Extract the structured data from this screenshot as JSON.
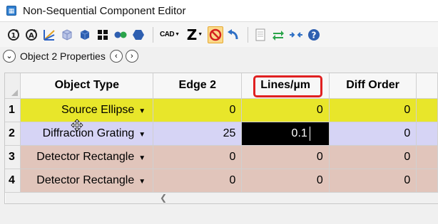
{
  "window": {
    "title": "Non-Sequential Component Editor"
  },
  "toolbar": {
    "cad_label": "CAD",
    "z_label": "Z"
  },
  "properties": {
    "label": "Object 2 Properties"
  },
  "table": {
    "columns": [
      "Object Type",
      "Edge 2",
      "Lines/µm",
      "Diff Order",
      ""
    ],
    "rows": [
      {
        "num": "1",
        "type": "Source Ellipse",
        "edge2": "0",
        "lines": "0",
        "diff": "0"
      },
      {
        "num": "2",
        "type": "Diffraction Grating",
        "edge2": "25",
        "lines": "0.1",
        "diff": "0"
      },
      {
        "num": "3",
        "type": "Detector Rectangle",
        "edge2": "0",
        "lines": "0",
        "diff": "0"
      },
      {
        "num": "4",
        "type": "Detector Rectangle",
        "edge2": "0",
        "lines": "0",
        "diff": "0"
      }
    ],
    "row_colors": [
      "#e8e62a",
      "#d6d4f5",
      "#e1c5bb",
      "#e1c5bb"
    ]
  },
  "colors": {
    "highlight": "#e02020",
    "editing_cell": "#000000"
  },
  "icons": [
    "rotate-cw-icon",
    "rotate-ccw-icon",
    "ray-trace-icon",
    "object-icon",
    "cube-icon",
    "grid-icon",
    "dots-icon",
    "hexagon-icon",
    "cad-icon",
    "z-icon",
    "no-entry-icon",
    "undo-icon",
    "document-icon",
    "arrows-swap-icon",
    "arrows-in-icon",
    "help-icon"
  ]
}
